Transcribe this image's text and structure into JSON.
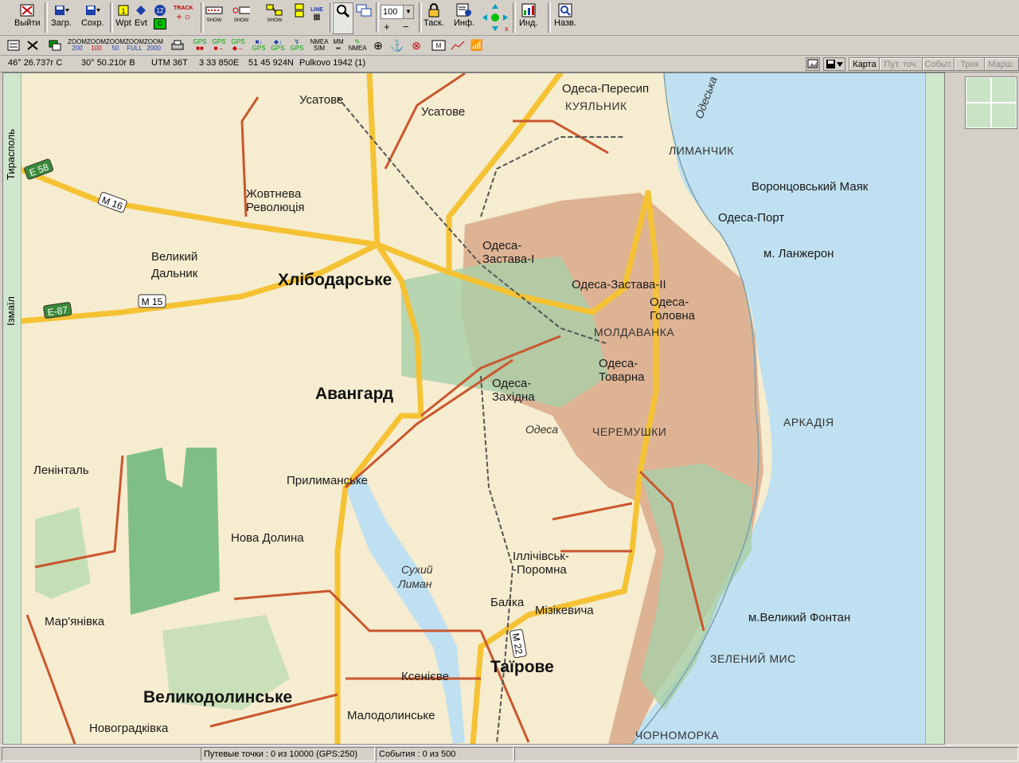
{
  "toolbar1": {
    "buttons": [
      {
        "id": "exit",
        "label": "Выйти",
        "icon": "exit-icon"
      },
      {
        "id": "load",
        "label": "Загр.",
        "icon": "load-icon"
      },
      {
        "id": "save",
        "label": "Сохр.",
        "icon": "save-icon"
      },
      {
        "id": "wpt",
        "label": "Wpt",
        "icon": "waypoint-icon"
      },
      {
        "id": "evt",
        "label": "Evt",
        "icon": "event-icon"
      },
      {
        "id": "task",
        "label": "Таск.",
        "icon": "lock-icon"
      },
      {
        "id": "info",
        "label": "Инф.",
        "icon": "info-icon"
      },
      {
        "id": "ind",
        "label": "Инд.",
        "icon": "indicator-icon"
      },
      {
        "id": "names",
        "label": "Назв.",
        "icon": "names-icon"
      }
    ],
    "badges": {
      "wpt_num": "1",
      "evt_num": "12",
      "track_label": "TRACK",
      "show_label": "SHOW",
      "show_label2": "SHOW",
      "show_label3": "SHOW",
      "line_label": "LINE"
    },
    "zoom_value": "100"
  },
  "toolbar2": {
    "zoom_buttons": [
      {
        "top": "ZOOM",
        "bottom": "200"
      },
      {
        "top": "ZOOM",
        "bottom": "100"
      },
      {
        "top": "ZOOM",
        "bottom": "50"
      },
      {
        "top": "ZOOM",
        "bottom": "FULL"
      },
      {
        "top": "ZOOM",
        "bottom": "2000"
      }
    ],
    "gps_buttons": [
      "GPS",
      "GPS",
      "GPS",
      "GPS",
      "GPS"
    ],
    "nmea_sim": {
      "top": "NMEA",
      "bottom": "SIM"
    },
    "mm": "MM",
    "nmea": "NMEA"
  },
  "coords": {
    "lat": "46° 26.737г С",
    "lon": "30° 50.210г В",
    "utm": "UTM  36T",
    "easting": "3 33 850E",
    "northing": "51 45 924N",
    "datum": "Pulkovo 1942 (1)"
  },
  "tabs": [
    {
      "label": "Карта",
      "enabled": true
    },
    {
      "label": "Пут. точ.",
      "enabled": false
    },
    {
      "label": "Событ.",
      "enabled": false
    },
    {
      "label": "Трек",
      "enabled": false
    },
    {
      "label": "Марш.",
      "enabled": false
    }
  ],
  "map": {
    "edge_labels": {
      "left_top": "Тирасполь",
      "left_bottom": "Ізмаїл"
    },
    "places": [
      {
        "id": "usatove-1",
        "text": "Усатове",
        "cls": "lbl"
      },
      {
        "id": "usatove-2",
        "text": "Усатове",
        "cls": "lbl"
      },
      {
        "id": "peresyp",
        "text": "Одеса-Пересип",
        "cls": "lbl"
      },
      {
        "id": "kuyalnyk",
        "text": "КУЯЛЬНИК",
        "cls": "lbl-caps"
      },
      {
        "id": "lymanchyk",
        "text": "ЛИМАНЧИК",
        "cls": "lbl-caps"
      },
      {
        "id": "vorontsov",
        "text": "Воронцовський  Маяк",
        "cls": "lbl"
      },
      {
        "id": "odesa-port",
        "text": "Одеса-Порт",
        "cls": "lbl"
      },
      {
        "id": "lanzheron",
        "text": "м. Ланжерон",
        "cls": "lbl"
      },
      {
        "id": "zhovtneva-1",
        "text": "Жовтнева",
        "cls": "lbl"
      },
      {
        "id": "zhovtneva-2",
        "text": "Революція",
        "cls": "lbl"
      },
      {
        "id": "velykyi-1",
        "text": "Великий",
        "cls": "lbl"
      },
      {
        "id": "velykyi-2",
        "text": "Дальник",
        "cls": "lbl"
      },
      {
        "id": "khlibodarske",
        "text": "Хлібодарське",
        "cls": "lbl-big"
      },
      {
        "id": "zastava1-1",
        "text": "Одеса-",
        "cls": "lbl"
      },
      {
        "id": "zastava1-2",
        "text": "Застава-І",
        "cls": "lbl"
      },
      {
        "id": "zastava2",
        "text": "Одеса-Застава-ІІ",
        "cls": "lbl"
      },
      {
        "id": "holovna-1",
        "text": "Одеса-",
        "cls": "lbl"
      },
      {
        "id": "holovna-2",
        "text": "Головна",
        "cls": "lbl"
      },
      {
        "id": "moldavanka",
        "text": "МОЛДАВАНКА",
        "cls": "lbl-caps"
      },
      {
        "id": "tovarna-1",
        "text": "Одеса-",
        "cls": "lbl"
      },
      {
        "id": "tovarna-2",
        "text": "Товарна",
        "cls": "lbl"
      },
      {
        "id": "avanhard",
        "text": "Авангард",
        "cls": "lbl-big"
      },
      {
        "id": "zakhidna-1",
        "text": "Одеса-",
        "cls": "lbl"
      },
      {
        "id": "zakhidna-2",
        "text": "Західна",
        "cls": "lbl"
      },
      {
        "id": "odesa-airport",
        "text": "Одеса",
        "cls": "lbl-it"
      },
      {
        "id": "cheremushky",
        "text": "ЧЕРЕМУШКИ",
        "cls": "lbl-caps"
      },
      {
        "id": "arkadiya",
        "text": "АРКАДІЯ",
        "cls": "lbl-caps"
      },
      {
        "id": "lenintal",
        "text": "Ленінталь",
        "cls": "lbl"
      },
      {
        "id": "prylymanske",
        "text": "Прилиманське",
        "cls": "lbl"
      },
      {
        "id": "nova-dolyna",
        "text": "Нова Долина",
        "cls": "lbl"
      },
      {
        "id": "sukhyi-1",
        "text": "Сухий",
        "cls": "lbl-it"
      },
      {
        "id": "sukhyi-2",
        "text": "Лиман",
        "cls": "lbl-it"
      },
      {
        "id": "illichivsk-1",
        "text": "Іллічівськ-",
        "cls": "lbl"
      },
      {
        "id": "illichivsk-2",
        "text": "-Поромна",
        "cls": "lbl"
      },
      {
        "id": "marianivka",
        "text": "Мар'янівка",
        "cls": "lbl"
      },
      {
        "id": "balka",
        "text": "Балка",
        "cls": "lbl"
      },
      {
        "id": "mizikevycha",
        "text": "Мізікевича",
        "cls": "lbl"
      },
      {
        "id": "velykyi-fontan",
        "text": "м.Великий Фонтан",
        "cls": "lbl"
      },
      {
        "id": "zelenyi-mys",
        "text": "ЗЕЛЕНИЙ МИС",
        "cls": "lbl-caps"
      },
      {
        "id": "tairove",
        "text": "Таїрове",
        "cls": "lbl-big"
      },
      {
        "id": "ksenievo",
        "text": "Ксенієве",
        "cls": "lbl"
      },
      {
        "id": "velykodolynske",
        "text": "Великодолинське",
        "cls": "lbl-big"
      },
      {
        "id": "malodolynske",
        "text": "Малодолинське",
        "cls": "lbl"
      },
      {
        "id": "novohradkivka",
        "text": "Новоградківка",
        "cls": "lbl"
      },
      {
        "id": "chornomorka",
        "text": "ЧОРНОМОРКА",
        "cls": "lbl-caps"
      },
      {
        "id": "odeska-zatoka",
        "text": "Одеська",
        "cls": "lbl-it"
      }
    ],
    "road_tags": [
      {
        "id": "e58",
        "text": "E 58",
        "green": true
      },
      {
        "id": "m16",
        "text": "M 16",
        "green": false
      },
      {
        "id": "e87",
        "text": "E-87",
        "green": true
      },
      {
        "id": "m15",
        "text": "M 15",
        "green": false
      },
      {
        "id": "m22",
        "text": "M 22",
        "green": false
      }
    ]
  },
  "status": {
    "waypoints": "Путевые точки : 0 из 10000  (GPS:250)",
    "events": "События : 0 из 500"
  },
  "colors": {
    "land": "#f6eccf",
    "sea": "#bfe0f0",
    "city": "#d9a98a",
    "green": "#a7cfa7",
    "road_main": "#f5c234",
    "road": "#c9572e"
  }
}
